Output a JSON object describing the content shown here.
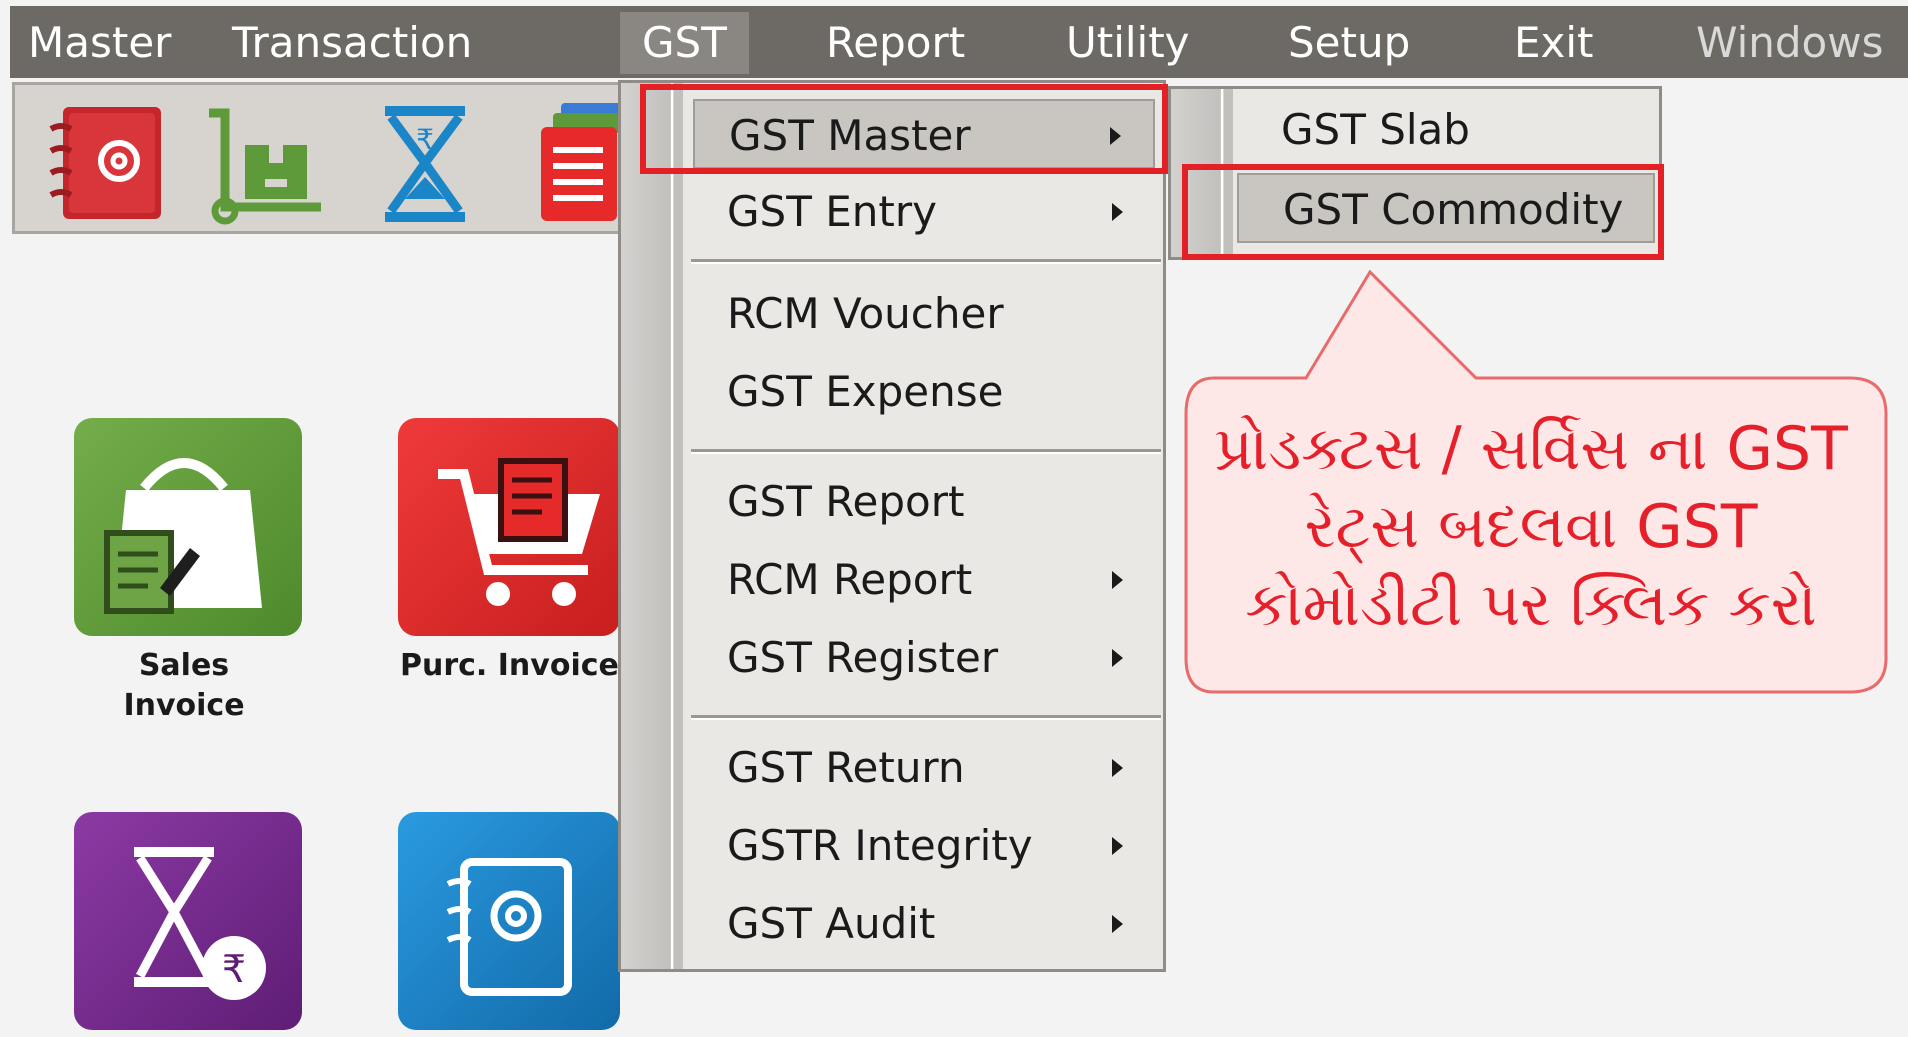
{
  "menubar": {
    "items": [
      {
        "label": "Master"
      },
      {
        "label": "Transaction"
      },
      {
        "label": "GST"
      },
      {
        "label": "Report"
      },
      {
        "label": "Utility"
      },
      {
        "label": "Setup"
      },
      {
        "label": "Exit"
      },
      {
        "label": "Windows"
      }
    ],
    "background": "#6d6a66"
  },
  "toolbar": {
    "icons": [
      "address-book-icon",
      "hand-truck-icon",
      "hourglass-rupee-icon",
      "stacked-documents-icon"
    ]
  },
  "tiles": [
    {
      "label_line1": "Sales",
      "label_line2": "Invoice",
      "color": "#5f9a3a"
    },
    {
      "label_line1": "Purc. Invoice",
      "label_line2": "",
      "color": "#e62a2a"
    },
    {
      "label_line1": "",
      "label_line2": "",
      "color": "#7b2b8f"
    },
    {
      "label_line1": "",
      "label_line2": "",
      "color": "#1a86c8"
    }
  ],
  "gst_menu": {
    "items": [
      {
        "label": "GST Master",
        "submenu": true,
        "highlighted": true
      },
      {
        "label": "GST Entry",
        "submenu": true
      },
      {
        "label": "RCM Voucher",
        "submenu": false
      },
      {
        "label": "GST Expense",
        "submenu": false
      },
      {
        "label": "GST Report",
        "submenu": false
      },
      {
        "label": "RCM Report",
        "submenu": true
      },
      {
        "label": "GST Register",
        "submenu": true
      },
      {
        "label": "GST Return",
        "submenu": true
      },
      {
        "label": "GSTR Integrity",
        "submenu": true
      },
      {
        "label": "GST Audit",
        "submenu": true
      }
    ]
  },
  "gst_submenu": {
    "items": [
      {
        "label": "GST Slab"
      },
      {
        "label": "GST Commodity",
        "highlighted": true
      }
    ]
  },
  "callout": {
    "text": "પ્રોડક્ટસ / સર્વિસ ના GST રેટ્સ બદલવા GST કોમોડીટી પર ક્લિક કરો",
    "color": "#e5202a",
    "fill": "#fde7e7"
  },
  "highlight_color": "#e32026"
}
